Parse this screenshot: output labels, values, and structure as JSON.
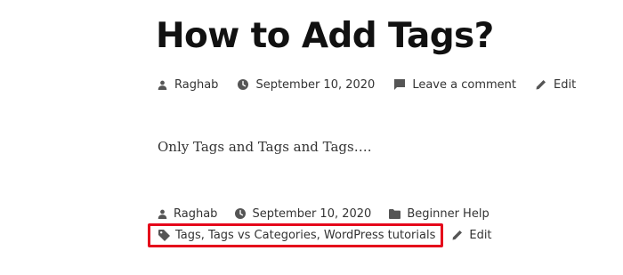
{
  "post": {
    "title": "How to Add Tags?",
    "content": "Only Tags and Tags and Tags….",
    "header_meta": {
      "author": "Raghab",
      "date": "September 10, 2020",
      "comments": "Leave a comment",
      "edit": "Edit"
    },
    "footer_meta": {
      "author": "Raghab",
      "date": "September 10, 2020",
      "category": "Beginner Help",
      "tags": "Tags, Tags vs Categories, WordPress tutorials",
      "edit": "Edit"
    }
  },
  "icons": {
    "author": "user-icon",
    "date": "clock-icon",
    "comments": "comment-icon",
    "edit": "pencil-icon",
    "category": "folder-icon",
    "tags": "tag-icon"
  },
  "colors": {
    "text": "#111111",
    "meta_text": "#333333",
    "icon": "#555555",
    "highlight_border": "#e5071b",
    "background": "#ffffff"
  }
}
